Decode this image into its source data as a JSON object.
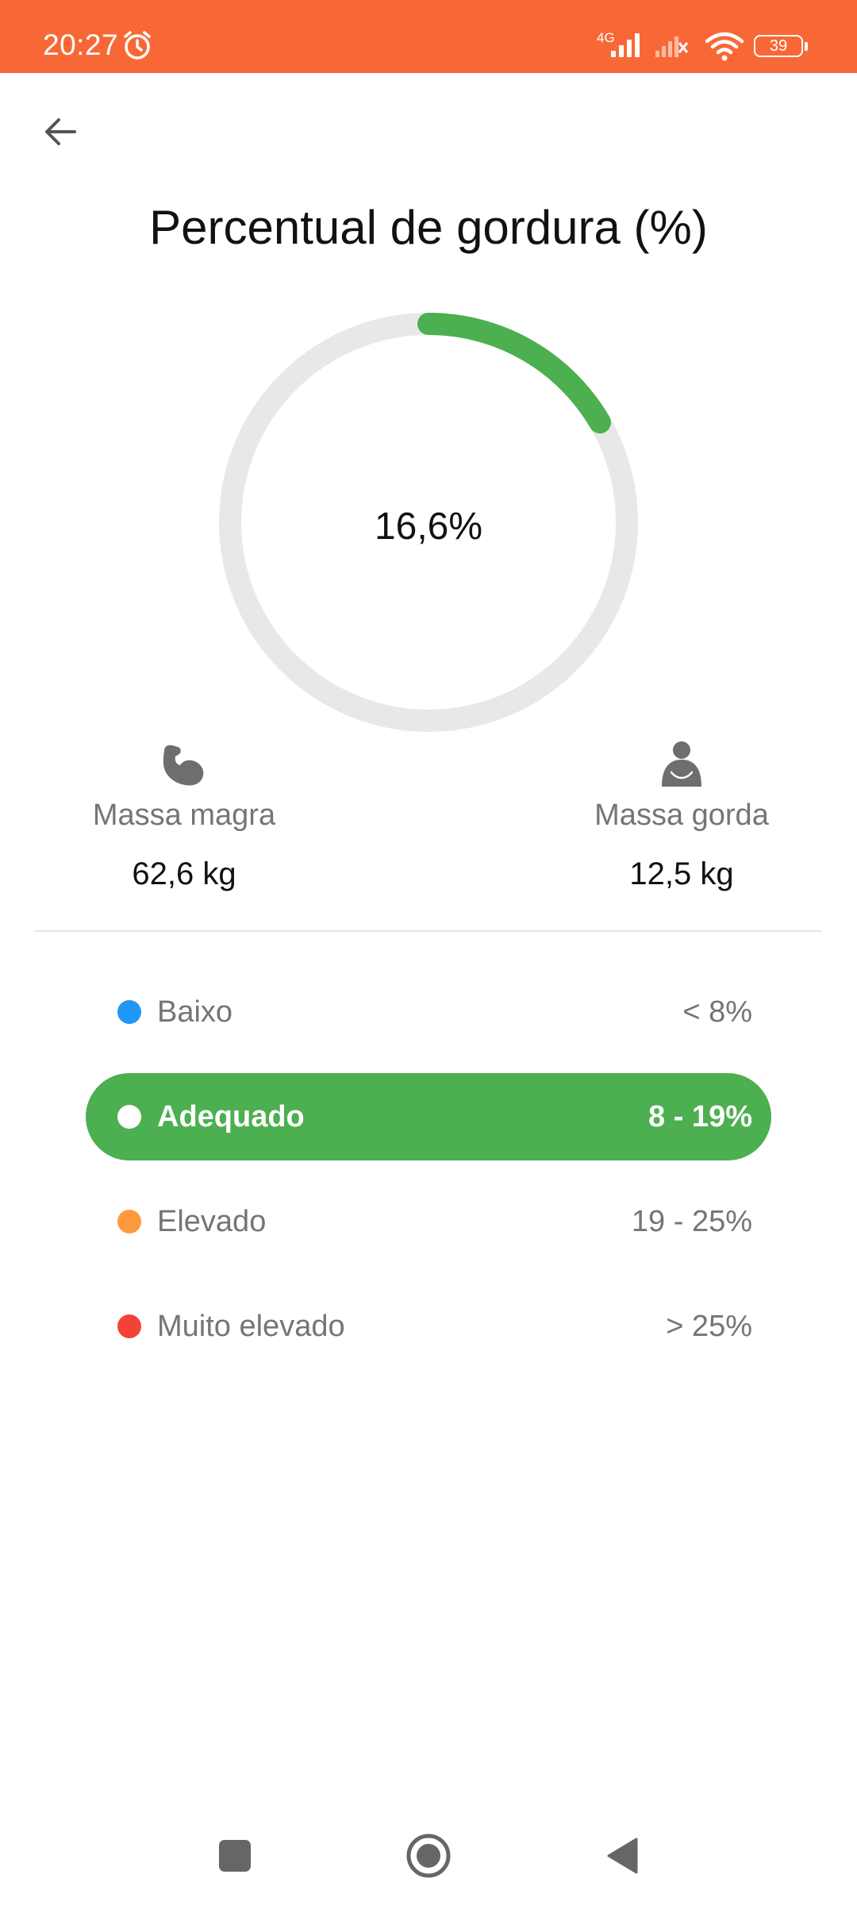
{
  "status_bar": {
    "time": "20:27",
    "network": "4G",
    "battery": "39",
    "icons": [
      "alarm-icon",
      "signal-icon",
      "signal-no-service-icon",
      "wifi-icon",
      "battery-icon"
    ],
    "background_color": "#f86836"
  },
  "header": {
    "back_icon": "arrow-left-icon",
    "title": "Percentual de gordura (%)"
  },
  "gauge": {
    "value_label": "16,6%",
    "value_percent": 16.6,
    "progress_color": "#4caf50",
    "track_color": "#e8e8e8"
  },
  "masses": {
    "lean": {
      "icon": "flexed-bicep-icon",
      "label": "Massa magra",
      "value": "62,6 kg"
    },
    "fat": {
      "icon": "person-icon",
      "label": "Massa gorda",
      "value": "12,5 kg"
    }
  },
  "ranges": [
    {
      "label": "Baixo",
      "value": "< 8%",
      "color": "#2196f3",
      "active": false
    },
    {
      "label": "Adequado",
      "value": "8 - 19%",
      "color": "#ffffff",
      "active": true
    },
    {
      "label": "Elevado",
      "value": "19 - 25%",
      "color": "#ff9a3c",
      "active": false
    },
    {
      "label": "Muito elevado",
      "value": "> 25%",
      "color": "#f44336",
      "active": false
    }
  ],
  "nav_bar": {
    "icons": [
      "recents-square-icon",
      "home-circle-icon",
      "back-triangle-icon"
    ]
  }
}
